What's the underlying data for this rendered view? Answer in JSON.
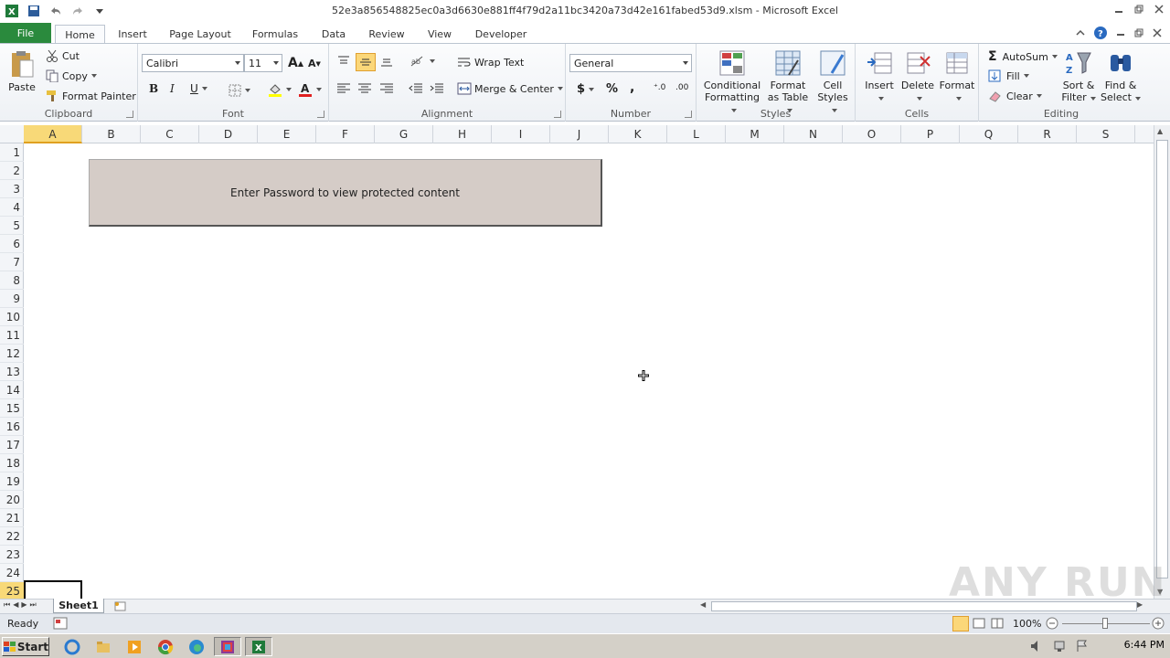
{
  "window": {
    "title": "52e3a856548825ec0a3d6630e881ff4f79d2a11bc3420a73d42e161fabed53d9.xlsm - Microsoft Excel"
  },
  "tabs": [
    "File",
    "Home",
    "Insert",
    "Page Layout",
    "Formulas",
    "Data",
    "Review",
    "View",
    "Developer"
  ],
  "ribbon": {
    "clipboard": {
      "label": "Clipboard",
      "paste": "Paste",
      "cut": "Cut",
      "copy": "Copy",
      "format_painter": "Format Painter"
    },
    "font": {
      "label": "Font",
      "font_name": "Calibri",
      "font_size": "11"
    },
    "alignment": {
      "label": "Alignment",
      "wrap_text": "Wrap Text",
      "merge_center": "Merge & Center"
    },
    "number": {
      "label": "Number",
      "format": "General"
    },
    "styles": {
      "label": "Styles",
      "conditional_1": "Conditional",
      "conditional_2": "Formatting",
      "format_table_1": "Format",
      "format_table_2": "as Table",
      "cell_styles_1": "Cell",
      "cell_styles_2": "Styles"
    },
    "cells": {
      "label": "Cells",
      "insert": "Insert",
      "delete": "Delete",
      "format": "Format"
    },
    "editing": {
      "label": "Editing",
      "autosum": "AutoSum",
      "fill": "Fill",
      "clear": "Clear",
      "sort_1": "Sort &",
      "sort_2": "Filter",
      "find_1": "Find &",
      "find_2": "Select"
    }
  },
  "columns": [
    "A",
    "B",
    "C",
    "D",
    "E",
    "F",
    "G",
    "H",
    "I",
    "J",
    "K",
    "L",
    "M",
    "N",
    "O",
    "P",
    "Q",
    "R",
    "S"
  ],
  "rows": [
    "1",
    "2",
    "3",
    "4",
    "5",
    "6",
    "7",
    "8",
    "9",
    "10",
    "11",
    "12",
    "13",
    "14",
    "15",
    "16",
    "17",
    "18",
    "19",
    "20",
    "21",
    "22",
    "23",
    "24",
    "25"
  ],
  "sheet": {
    "button_text": "Enter Password to view protected content",
    "tab": "Sheet1"
  },
  "status": {
    "ready": "Ready",
    "zoom": "100%"
  },
  "taskbar": {
    "start": "Start",
    "clock": "6:44 PM"
  },
  "watermark": "ANY RUN"
}
